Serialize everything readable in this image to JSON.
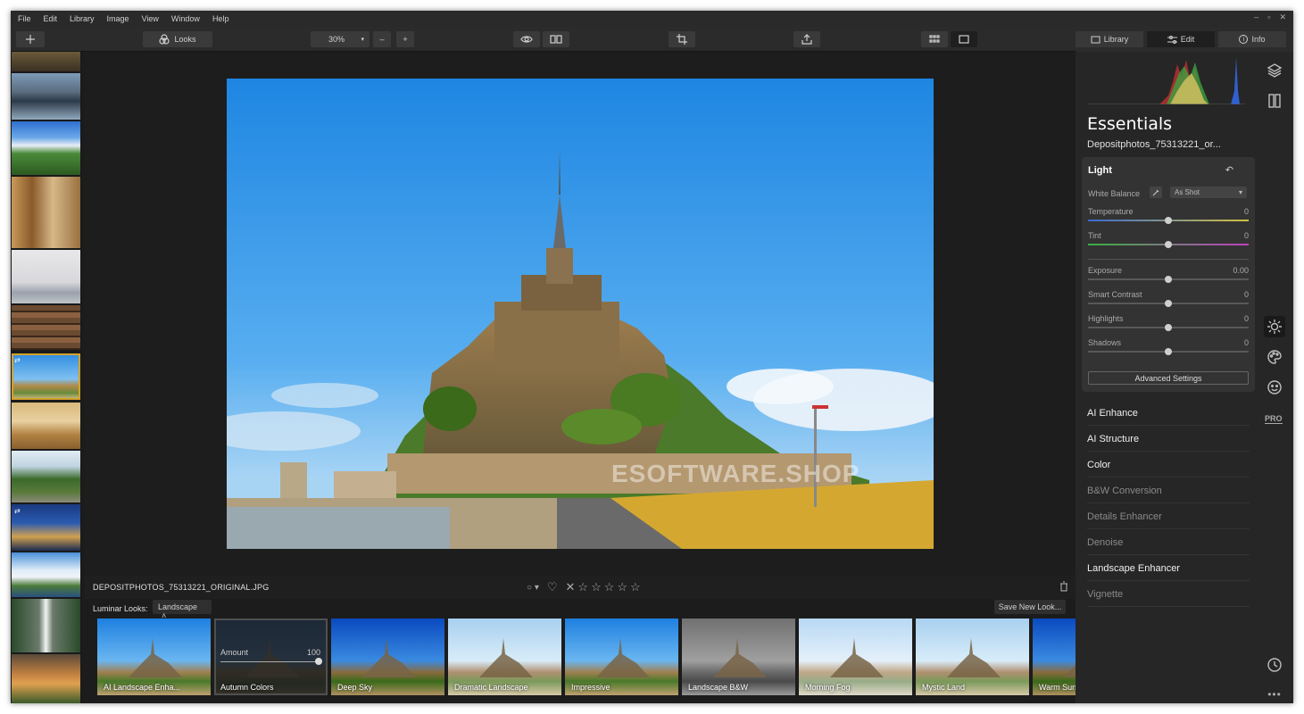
{
  "menu": [
    "File",
    "Edit",
    "Library",
    "Image",
    "View",
    "Window",
    "Help"
  ],
  "window_controls": [
    "–",
    "▫",
    "✕"
  ],
  "toolbar": {
    "looks_label": "Looks",
    "zoom": "30%",
    "zoom_minus": "–",
    "zoom_plus": "+",
    "add_icon": "plus-icon"
  },
  "tabs": {
    "library": "Library",
    "edit": "Edit",
    "info": "Info"
  },
  "essentials": {
    "title": "Essentials",
    "filename": "Depositphotos_75313221_or..."
  },
  "light": {
    "title": "Light",
    "white_balance_label": "White Balance",
    "white_balance_value": "As Shot",
    "sliders": [
      {
        "label": "Temperature",
        "value": "0",
        "position": 0.5
      },
      {
        "label": "Tint",
        "value": "0",
        "position": 0.5
      },
      {
        "label": "Exposure",
        "value": "0.00",
        "position": 0.5
      },
      {
        "label": "Smart Contrast",
        "value": "0",
        "position": 0.5
      },
      {
        "label": "Highlights",
        "value": "0",
        "position": 0.5
      },
      {
        "label": "Shadows",
        "value": "0",
        "position": 0.5
      }
    ],
    "advanced_label": "Advanced Settings"
  },
  "filters": [
    {
      "label": "AI Enhance",
      "active": true
    },
    {
      "label": "AI Structure",
      "active": true
    },
    {
      "label": "Color",
      "active": true
    },
    {
      "label": "B&W Conversion",
      "active": false
    },
    {
      "label": "Details Enhancer",
      "active": false
    },
    {
      "label": "Denoise",
      "active": false
    },
    {
      "label": "Landscape Enhancer",
      "active": true
    },
    {
      "label": "Vignette",
      "active": false
    }
  ],
  "pro_label": "PRO",
  "infobar": {
    "filename": "DEPOSITPHOTOS_75313221_ORIGINAL.JPG",
    "rating_stars": 5
  },
  "looks": {
    "label": "Luminar Looks:",
    "category": "Landscape",
    "save_label": "Save New Look...",
    "amount_label": "Amount",
    "amount_value": "100",
    "items": [
      {
        "label": "AI Landscape Enha...",
        "style": "normal"
      },
      {
        "label": "Autumn Colors",
        "style": "dim"
      },
      {
        "label": "Deep Sky",
        "style": "deep"
      },
      {
        "label": "Dramatic Landscape",
        "style": "light"
      },
      {
        "label": "Impressive",
        "style": "normal"
      },
      {
        "label": "Landscape B&W",
        "style": "bw"
      },
      {
        "label": "Morning Fog",
        "style": "fog"
      },
      {
        "label": "Mystic Land",
        "style": "light"
      },
      {
        "label": "Warm Sunset",
        "style": "deep"
      }
    ]
  },
  "watermark": "ESOFTWARE.SHOP",
  "colors": {
    "accent_selected": "#d4a12a",
    "sky": "#3aa0ea",
    "panel": "#262626"
  }
}
